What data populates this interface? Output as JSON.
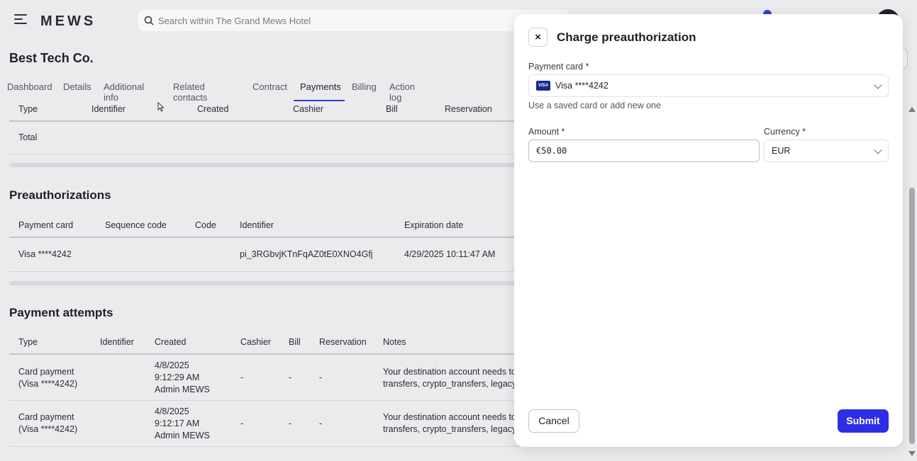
{
  "header": {
    "logo": "MEWS",
    "search_placeholder": "Search within The Grand Mews Hotel"
  },
  "page": {
    "company_name": "Best Tech Co."
  },
  "tabs": [
    "Dashboard",
    "Details",
    "Additional info",
    "Related contacts",
    "Contract",
    "Payments",
    "Billing",
    "Action log"
  ],
  "active_tab": "Payments",
  "payments_table": {
    "columns": [
      "Type",
      "Identifier",
      "Created",
      "Cashier",
      "Bill",
      "Reservation"
    ],
    "total_label": "Total"
  },
  "preauthorizations": {
    "title": "Preauthorizations",
    "columns": [
      "Payment card",
      "Sequence code",
      "Code",
      "Identifier",
      "Expiration date"
    ],
    "rows": [
      {
        "card": "Visa ****4242",
        "sequence": "",
        "code": "",
        "identifier": "pi_3RGbvjKTnFqAZ0tE0XNO4Gfj",
        "expiration": "4/29/2025 10:11:47 AM"
      }
    ]
  },
  "payment_attempts": {
    "title": "Payment attempts",
    "columns": [
      "Type",
      "Identifier",
      "Created",
      "Cashier",
      "Bill",
      "Reservation",
      "Notes"
    ],
    "rows": [
      {
        "type1": "Card payment",
        "type2": "(Visa ****4242)",
        "identifier": "",
        "created1": "4/8/2025",
        "created2": "9:12:29 AM",
        "created3": "Admin MEWS",
        "cashier": "-",
        "bill": "-",
        "reservation": "-",
        "notes1": "Your destination account needs to",
        "notes2": "transfers, crypto_transfers, legacy"
      },
      {
        "type1": "Card payment",
        "type2": "(Visa ****4242)",
        "identifier": "",
        "created1": "4/8/2025",
        "created2": "9:12:17 AM",
        "created3": "Admin MEWS",
        "cashier": "-",
        "bill": "-",
        "reservation": "-",
        "notes1": "Your destination account needs to",
        "notes2": "transfers, crypto_transfers, legacy"
      }
    ]
  },
  "modal": {
    "title": "Charge preauthorization",
    "payment_card_label": "Payment card *",
    "payment_card_value": "Visa ****4242",
    "visa_badge": "VISA",
    "payment_card_helper": "Use a saved card or add new one",
    "amount_label": "Amount *",
    "amount_value": "€50.00",
    "currency_label": "Currency *",
    "currency_value": "EUR",
    "cancel_label": "Cancel",
    "submit_label": "Submit",
    "close_glyph": "×"
  },
  "colors": {
    "accent": "#2e2ee6",
    "tab_underline": "#2f3bdb",
    "background": "#ebebed"
  }
}
